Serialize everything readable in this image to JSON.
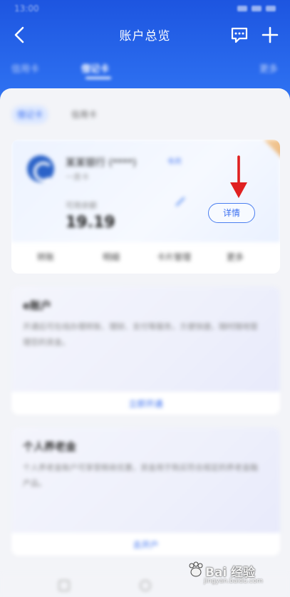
{
  "status_bar": {
    "time": "13:00"
  },
  "nav": {
    "title": "账户总览"
  },
  "tabs": [
    {
      "label": "信用卡"
    },
    {
      "label": "借记卡"
    },
    {
      "label": "更多"
    }
  ],
  "subtabs": {
    "active": "借记卡",
    "other": "信用卡"
  },
  "account_card": {
    "bank_name": "某某银行 (****)",
    "tag": "卡片",
    "sub": "一类卡",
    "balance_label": "可用余额",
    "balance_value": "19.19",
    "detail_label": "详情",
    "actions": [
      "转账",
      "明细",
      "卡片管理",
      "更多"
    ]
  },
  "promo_cards": [
    {
      "title": "e账户",
      "text": "开通后可在线办理转账、理财、支付等服务，方便快捷，随时随地管理您的资金。",
      "link": "立即开通"
    },
    {
      "title": "个人养老金",
      "text": "个人养老金账户可享受税收优惠，资金用于购买符合规定的养老金融产品。",
      "link": "去开户"
    }
  ],
  "watermark": {
    "brand": "Bai 经验",
    "sub": "jingyan.baidu.com"
  },
  "colors": {
    "header": "#2d6ff0",
    "accent": "#3a6ff0",
    "arrow": "#e02020"
  }
}
